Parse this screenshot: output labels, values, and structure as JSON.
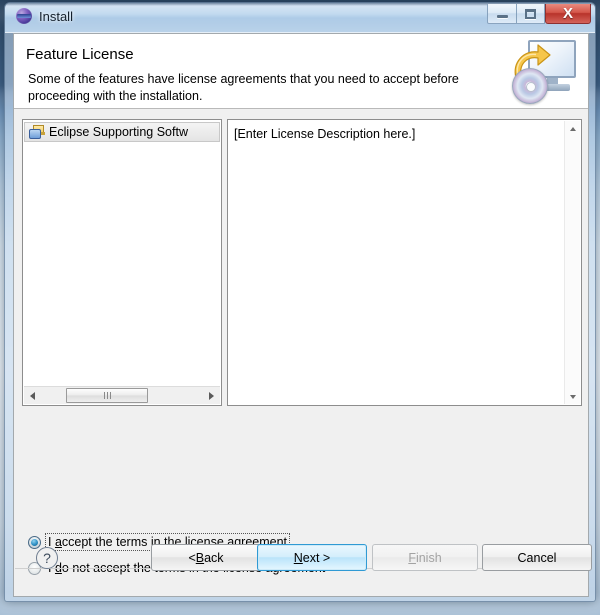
{
  "window": {
    "title": "Install",
    "app_icon": "eclipse-sphere-icon",
    "controls": {
      "minimize": "minimize-icon",
      "maximize": "maximize-icon",
      "close": "X"
    }
  },
  "header": {
    "title": "Feature License",
    "description": "Some of the features have license agreements that you need to accept before proceeding with the installation.",
    "icon": "install-monitor-disc-icon"
  },
  "feature_list": {
    "items": [
      {
        "label": "Eclipse Supporting Softw",
        "icon": "feature-plugin-icon",
        "selected": true
      }
    ],
    "hscroll": {
      "left_arrow": "scroll-left-icon",
      "right_arrow": "scroll-right-icon"
    }
  },
  "license_panel": {
    "text": "[Enter License Description here.]",
    "vscroll": {
      "up_arrow": "scroll-up-icon",
      "down_arrow": "scroll-down-icon"
    }
  },
  "radios": [
    {
      "id": "accept",
      "pre": "I ",
      "mnemonic": "a",
      "post": "ccept the terms in the license agreement",
      "checked": true,
      "focused": true
    },
    {
      "id": "decline",
      "pre": "I ",
      "mnemonic": "d",
      "post": "o not accept the terms in the license agreement",
      "checked": false,
      "focused": false
    }
  ],
  "buttons": {
    "help": "?",
    "back": "< Back",
    "back_pre": "< ",
    "back_mnemonic": "B",
    "back_post": "ack",
    "next_pre": "",
    "next_mnemonic": "N",
    "next_post": "ext >",
    "finish_mnemonic": "F",
    "finish_post": "inish",
    "cancel": "Cancel"
  },
  "colors": {
    "accent_default_button": "#2f9ad4",
    "close_button": "#b8332a",
    "dialog_bg": "#f0f0f0",
    "header_bg": "#ffffff",
    "radio_selected": "#2d8fc4"
  }
}
